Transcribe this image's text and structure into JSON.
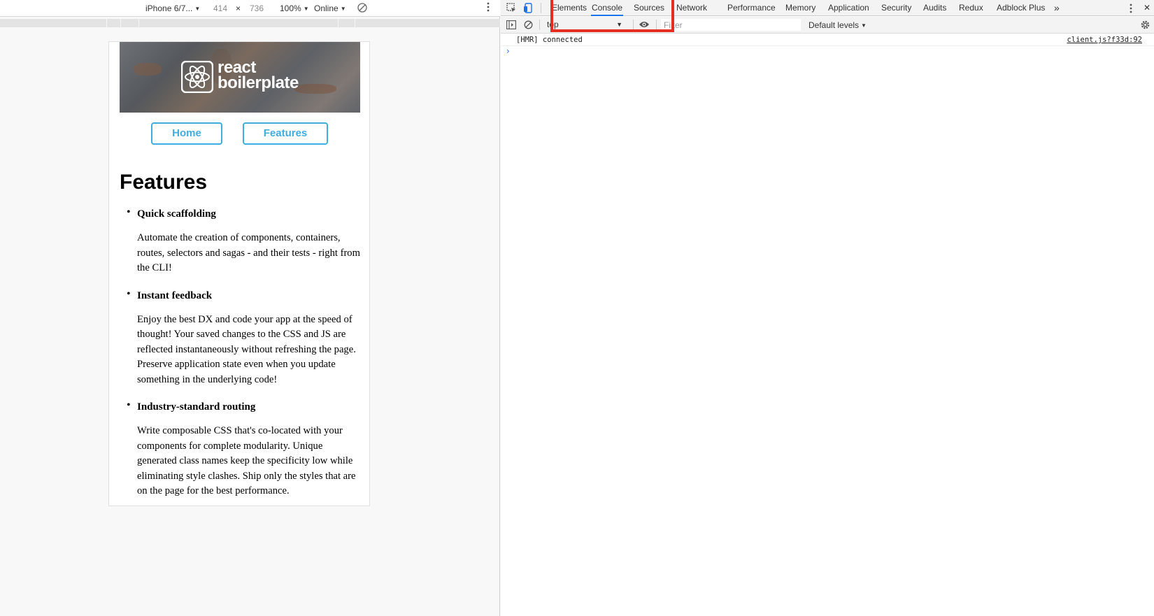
{
  "device_toolbar": {
    "device": "iPhone 6/7...",
    "width": "414",
    "times": "×",
    "height": "736",
    "zoom": "100%",
    "network": "Online"
  },
  "site": {
    "logo_line1": "react",
    "logo_line2": "boilerplate",
    "nav": {
      "home": "Home",
      "features": "Features"
    },
    "title": "Features",
    "features": [
      {
        "title": "Quick scaffolding",
        "desc": "Automate the creation of components, containers, routes, selectors and sagas - and their tests - right from the CLI!"
      },
      {
        "title": "Instant feedback",
        "desc": "Enjoy the best DX and code your app at the speed of thought! Your saved changes to the CSS and JS are reflected instantaneously without refreshing the page. Preserve application state even when you update something in the underlying code!"
      },
      {
        "title": "Industry-standard routing",
        "desc": "Write composable CSS that's co-located with your components for complete modularity. Unique generated class names keep the specificity low while eliminating style clashes. Ship only the styles that are on the page for the best performance."
      }
    ]
  },
  "devtools": {
    "tabs": [
      "Elements",
      "Console",
      "Sources",
      "Network",
      "Performance",
      "Memory",
      "Application",
      "Security",
      "Audits",
      "Redux",
      "Adblock Plus"
    ],
    "more": "»",
    "close": "✕",
    "console": {
      "context": "top",
      "filter_placeholder": "Filter",
      "levels": "Default levels",
      "log_message": "[HMR] connected",
      "log_source": "client.js?f33d:92",
      "prompt": "›"
    }
  },
  "colors": {
    "accent": "#41addd",
    "highlight": "#e52d22",
    "tab_active": "#1a73e8"
  }
}
